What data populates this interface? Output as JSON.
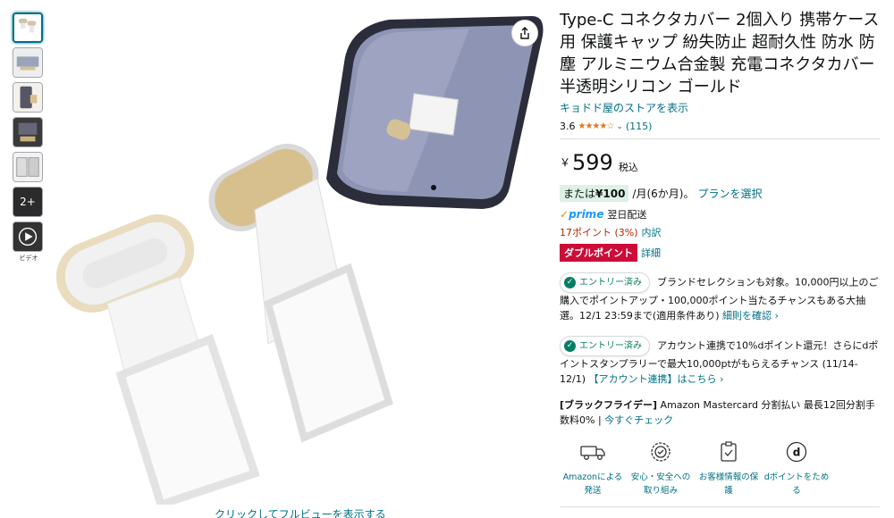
{
  "gallery": {
    "thumb_more_label": "2+",
    "video_label": "ビデオ",
    "fullview_text": "クリックしてフルビューを表示する"
  },
  "product": {
    "title": "Type-C コネクタカバー 2個入り 携帯ケース用 保護キャップ 紛失防止 超耐久性 防水 防塵 アルミニウム合金製 充電コネクタカバー 半透明シリコン ゴールド",
    "store_link": "キョドド屋のストアを表示",
    "rating_value": "3.6",
    "rating_stars": "★★★★☆",
    "rating_count": "(115)"
  },
  "price": {
    "currency": "￥",
    "amount": "599",
    "tax_label": "税込"
  },
  "installment": {
    "prefix": "または",
    "amount": "¥100",
    "period": "/月(6か月)。",
    "link": "プランを選択"
  },
  "shipping": {
    "prime_label": "prime",
    "delivery": "翌日配送"
  },
  "points": {
    "value": "17ポイント (3%)",
    "link": "内訳"
  },
  "double_point": {
    "badge": "ダブルポイント",
    "link": "詳細"
  },
  "promotions": [
    {
      "badge": "エントリー済み",
      "text": "ブランドセレクションも対象。10,000円以上のご購入でポイントアップ・100,000ポイント当たるチャンスもある大抽選。12/1 23:59まで(適用条件あり)",
      "link": "細則を確認 ›"
    },
    {
      "badge": "エントリー済み",
      "text": "アカウント連携で10%dポイント還元！さらにdポイントスタンプラリーで最大10,000ptがもらえるチャンス (11/14-12/1)",
      "link": "【アカウント連携】はこちら ›"
    }
  ],
  "black_friday": {
    "bold": "[ブラックフライデー]",
    "text": " Amazon Mastercard 分割払い 最長12回分割手数料0% | ",
    "link": "今すぐチェック"
  },
  "features": [
    {
      "icon": "truck-icon",
      "label": "Amazonによる発送"
    },
    {
      "icon": "shield-badge-icon",
      "label": "安心・安全への取り組み"
    },
    {
      "icon": "lock-clipboard-icon",
      "label": "お客様情報の保護"
    },
    {
      "icon": "d-point-icon",
      "label": "dポイントをためる"
    }
  ],
  "colors": {
    "link": "#007185",
    "price_red": "#b12704",
    "badge_red": "#cc0c39",
    "star": "#de7921",
    "entry_green": "#067d62"
  }
}
